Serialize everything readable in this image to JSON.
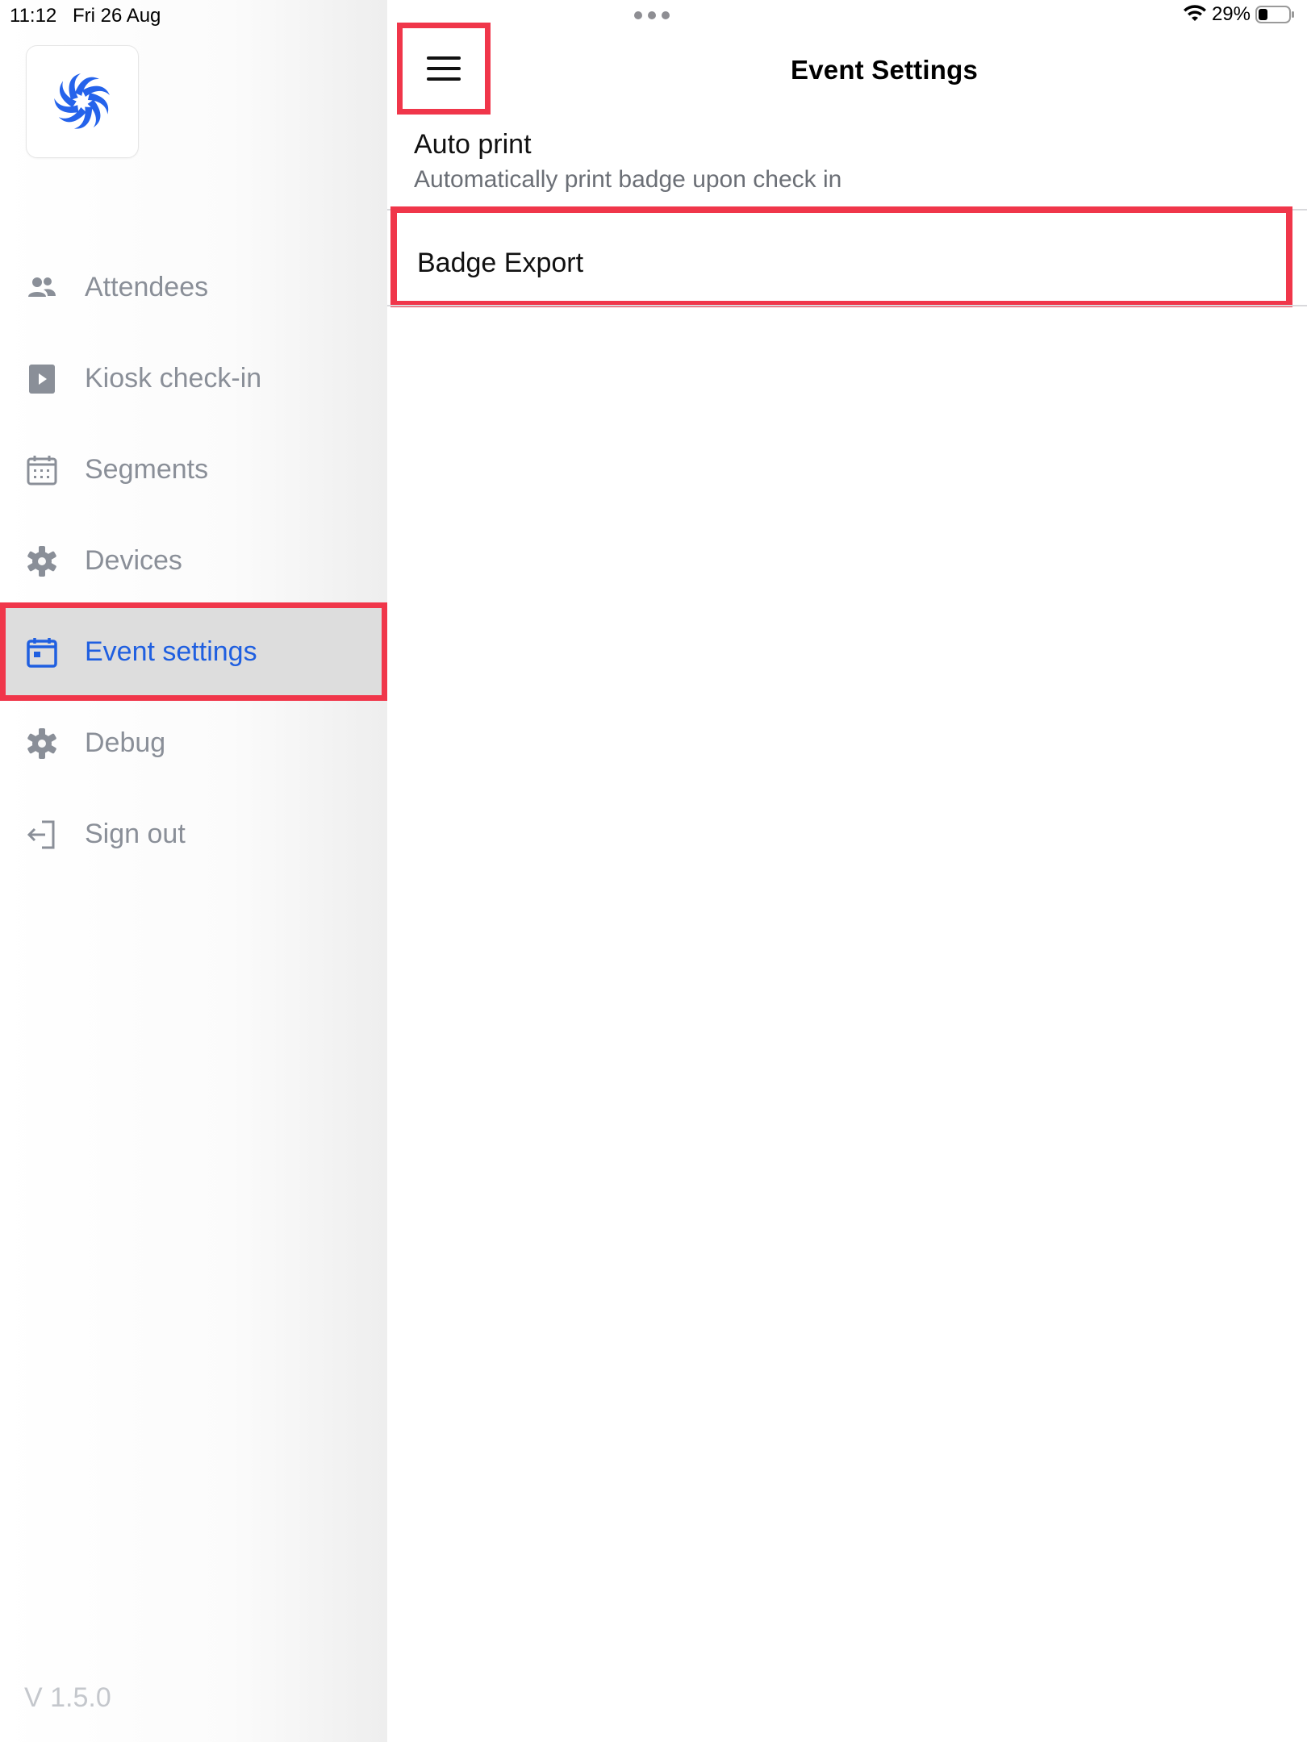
{
  "status_bar": {
    "time": "11:12",
    "date": "Fri 26 Aug",
    "battery_percent": "29%"
  },
  "sidebar": {
    "items": [
      {
        "label": "Attendees",
        "icon": "people-icon"
      },
      {
        "label": "Kiosk check-in",
        "icon": "play-square-icon"
      },
      {
        "label": "Segments",
        "icon": "calendar-grid-icon"
      },
      {
        "label": "Devices",
        "icon": "gear-icon"
      },
      {
        "label": "Event settings",
        "icon": "calendar-icon",
        "active": true
      },
      {
        "label": "Debug",
        "icon": "gear-icon"
      },
      {
        "label": "Sign out",
        "icon": "sign-out-icon"
      }
    ],
    "version": "V 1.5.0"
  },
  "header": {
    "title": "Event Settings"
  },
  "settings": {
    "auto_print": {
      "title": "Auto print",
      "subtitle": "Automatically print badge upon check in"
    },
    "badge_export": {
      "title": "Badge Export"
    }
  },
  "colors": {
    "accent": "#1f5fe0",
    "highlight": "#f0364a",
    "nav_text": "#8a8f98",
    "active_bg": "#dddddd"
  }
}
